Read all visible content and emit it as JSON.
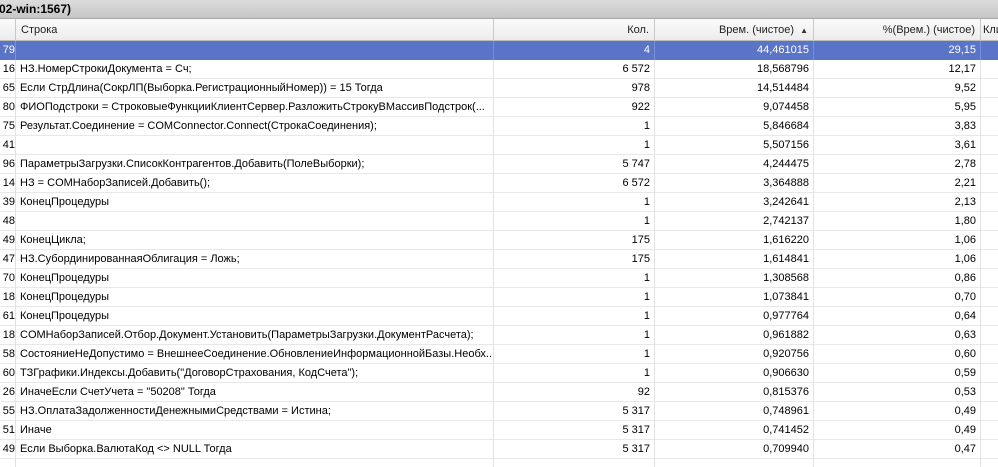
{
  "window": {
    "title": "02-win:1567)"
  },
  "columns": {
    "string": "Строка",
    "count": "Кол.",
    "time": "Врем. (чистое)",
    "percent": "%(Врем.) (чистое)",
    "client": "Кли"
  },
  "rows": [
    {
      "id": "79",
      "string": "",
      "count": "4",
      "time": "44,461015",
      "percent": "29,15"
    },
    {
      "id": "16",
      "string": "НЗ.НомерСтрокиДокумента = Сч;",
      "count": "6 572",
      "time": "18,568796",
      "percent": "12,17"
    },
    {
      "id": "65",
      "string": "Если СтрДлина(СокрЛП(Выборка.РегистрационныйНомер)) = 15 Тогда",
      "count": "978",
      "time": "14,514484",
      "percent": "9,52"
    },
    {
      "id": "80",
      "string": "ФИОПодстроки = СтроковыеФункцииКлиентСервер.РазложитьСтрокуВМассивПодстрок(...",
      "count": "922",
      "time": "9,074458",
      "percent": "5,95"
    },
    {
      "id": "75",
      "string": "Результат.Соединение = COMConnector.Connect(СтрокаСоединения);",
      "count": "1",
      "time": "5,846684",
      "percent": "3,83"
    },
    {
      "id": "41",
      "string": "",
      "count": "1",
      "time": "5,507156",
      "percent": "3,61"
    },
    {
      "id": "96",
      "string": "ПараметрыЗагрузки.СписокКонтрагентов.Добавить(ПолеВыборки);",
      "count": "5 747",
      "time": "4,244475",
      "percent": "2,78"
    },
    {
      "id": "14",
      "string": "НЗ = COMНаборЗаписей.Добавить();",
      "count": "6 572",
      "time": "3,364888",
      "percent": "2,21"
    },
    {
      "id": "39",
      "string": "КонецПроцедуры",
      "count": "1",
      "time": "3,242641",
      "percent": "2,13"
    },
    {
      "id": "48",
      "string": "",
      "count": "1",
      "time": "2,742137",
      "percent": "1,80"
    },
    {
      "id": "49",
      "string": "КонецЦикла;",
      "count": "175",
      "time": "1,616220",
      "percent": "1,06"
    },
    {
      "id": "47",
      "string": "НЗ.СубординированнаяОблигация = Ложь;",
      "count": "175",
      "time": "1,614841",
      "percent": "1,06"
    },
    {
      "id": "70",
      "string": "КонецПроцедуры",
      "count": "1",
      "time": "1,308568",
      "percent": "0,86"
    },
    {
      "id": "18",
      "string": "КонецПроцедуры",
      "count": "1",
      "time": "1,073841",
      "percent": "0,70"
    },
    {
      "id": "61",
      "string": "КонецПроцедуры",
      "count": "1",
      "time": "0,977764",
      "percent": "0,64"
    },
    {
      "id": "18",
      "string": "COMНаборЗаписей.Отбор.Документ.Установить(ПараметрыЗагрузки.ДокументРасчета);",
      "count": "1",
      "time": "0,961882",
      "percent": "0,63"
    },
    {
      "id": "58",
      "string": "СостояниеНеДопустимо = ВнешнееСоединение.ОбновлениеИнформационнойБазы.Необх...",
      "count": "1",
      "time": "0,920756",
      "percent": "0,60"
    },
    {
      "id": "60",
      "string": "ТЗГрафики.Индексы.Добавить(\"ДоговорСтрахования, КодСчета\");",
      "count": "1",
      "time": "0,906630",
      "percent": "0,59"
    },
    {
      "id": "26",
      "string": "ИначеЕсли СчетУчета = \"50208\" Тогда",
      "count": "92",
      "time": "0,815376",
      "percent": "0,53"
    },
    {
      "id": "55",
      "string": "НЗ.ОплатаЗадолженностиДенежнымиСредствами = Истина;",
      "count": "5 317",
      "time": "0,748961",
      "percent": "0,49"
    },
    {
      "id": "51",
      "string": "Иначе",
      "count": "5 317",
      "time": "0,741452",
      "percent": "0,49"
    },
    {
      "id": "49",
      "string": "Если Выборка.ВалютаКод <> NULL Тогда",
      "count": "5 317",
      "time": "0,709940",
      "percent": "0,47"
    },
    {
      "id": "",
      "string": "",
      "count": "",
      "time": "",
      "percent": ""
    }
  ],
  "colors": {
    "selection": "#5a74c7"
  }
}
